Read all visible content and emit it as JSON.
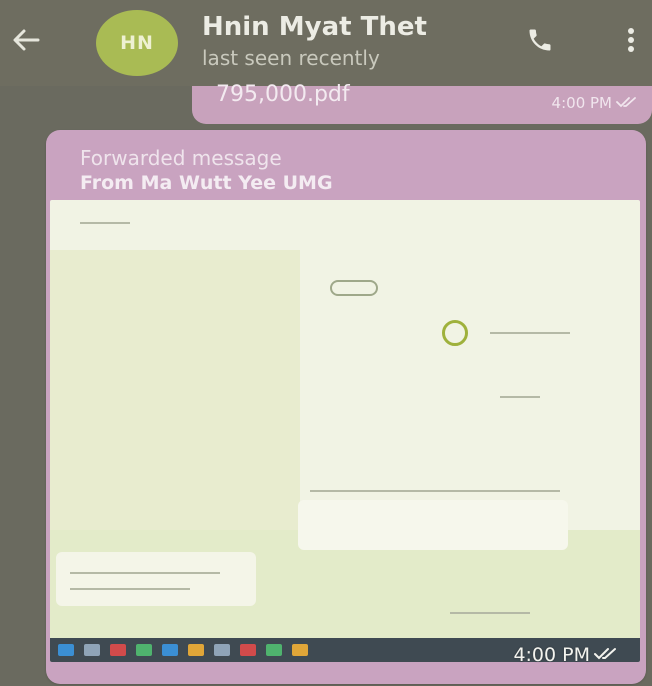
{
  "header": {
    "avatar_initials": "HN",
    "contact_name": "Hnin Myat Thet",
    "status": "last seen recently"
  },
  "messages": {
    "file": {
      "name": "795,000.pdf",
      "time": "4:00 PM"
    },
    "forwarded": {
      "label": "Forwarded message",
      "from": "From Ma Wutt Yee UMG",
      "time": "4:00 PM"
    }
  },
  "icons": {
    "back": "arrow-left-icon",
    "call": "phone-icon",
    "more": "vertical-dots-icon",
    "read": "double-check-icon"
  },
  "colors": {
    "header_bg": "#6e6d60",
    "avatar_bg": "#a9bb54",
    "bubble_bg": "#c9a3c0"
  }
}
